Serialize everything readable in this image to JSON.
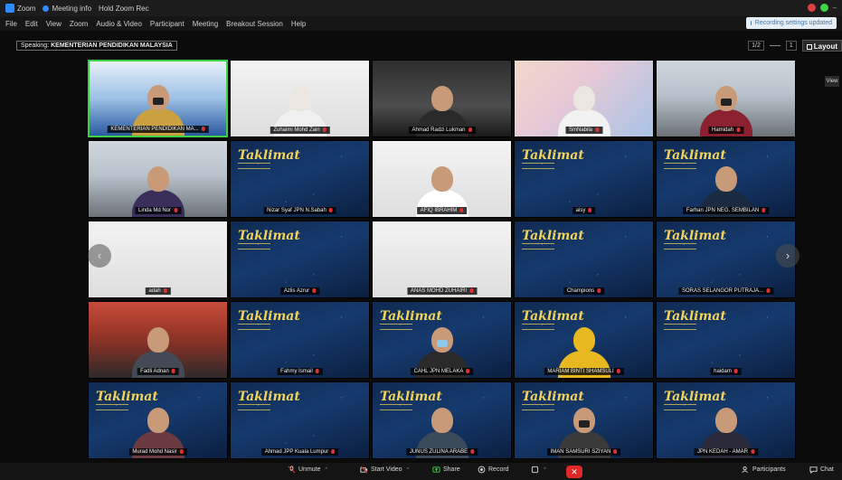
{
  "titlebar": {
    "app_title": "Zoom",
    "tab_label": "Meeting info",
    "view_label": "Hold Zoom Rec",
    "colors": {
      "close": "#e03e3e",
      "min": "#3fd14a"
    }
  },
  "menubar": {
    "items": [
      "File",
      "Edit",
      "View",
      "Zoom",
      "Audio & Video",
      "Participant",
      "Meeting",
      "Breakout Session",
      "Help"
    ],
    "notification": "Recording settings updated"
  },
  "speaking": {
    "prefix": "Speaking:",
    "name": "KEMENTERIAN PENDIDIKAN MALAYSIA"
  },
  "view_controls": {
    "page": "1/2",
    "gallery": "1",
    "view_label": "Layout"
  },
  "side_label": "View",
  "tiles": [
    {
      "name": "KEMENTERIAN PENDIDIKAN MA...",
      "bg": "banner"
    },
    {
      "name": "Zuhaimi Mohd Zain",
      "bg": "white"
    },
    {
      "name": "Ahmad Radzi Lukman",
      "bg": "dark"
    },
    {
      "name": "SmNabila",
      "bg": "colorful"
    },
    {
      "name": "Hamidah",
      "bg": "office"
    },
    {
      "name": "Linda Md Nor",
      "bg": "office"
    },
    {
      "name": "Nizar Syaf JPN N.Sabah",
      "bg": "blue"
    },
    {
      "name": "AFIQ IBRAHIM",
      "bg": "white"
    },
    {
      "name": "aisy",
      "bg": "blue"
    },
    {
      "name": "Farhan JPN NEG. SEMBILAN",
      "bg": "blue"
    },
    {
      "name": "adah",
      "bg": "white"
    },
    {
      "name": "Azlis Azrur",
      "bg": "blue"
    },
    {
      "name": "ANAS MOHD ZUHAIRI",
      "bg": "white"
    },
    {
      "name": "Champions",
      "bg": "blue"
    },
    {
      "name": "SORAS SELANGOR PUTRAJA...",
      "bg": "blue"
    },
    {
      "name": "Fadli Adnan",
      "bg": "red"
    },
    {
      "name": "Fahmy Ismail",
      "bg": "blue"
    },
    {
      "name": "CAHL JPN MELAKA",
      "bg": "blue"
    },
    {
      "name": "MARIAM BINTI SHAMSULI",
      "bg": "blue"
    },
    {
      "name": "haidam",
      "bg": "blue"
    },
    {
      "name": "Murad Mohd Nasir",
      "bg": "blue"
    },
    {
      "name": "Ahmad JPP Kuala Lumpur",
      "bg": "blue"
    },
    {
      "name": "JUNUS ZULINA ARABE",
      "bg": "blue"
    },
    {
      "name": "IMAN SAMSURI SZIYAN",
      "bg": "blue"
    },
    {
      "name": "JPN KEDAH - AMAR",
      "bg": "blue"
    }
  ],
  "banner_text": "Taklimat",
  "toolbar": {
    "unmute": "Unmute",
    "video": "Start Video",
    "share": "Share",
    "record": "Record",
    "participants": "Participants",
    "chat": "Chat"
  }
}
